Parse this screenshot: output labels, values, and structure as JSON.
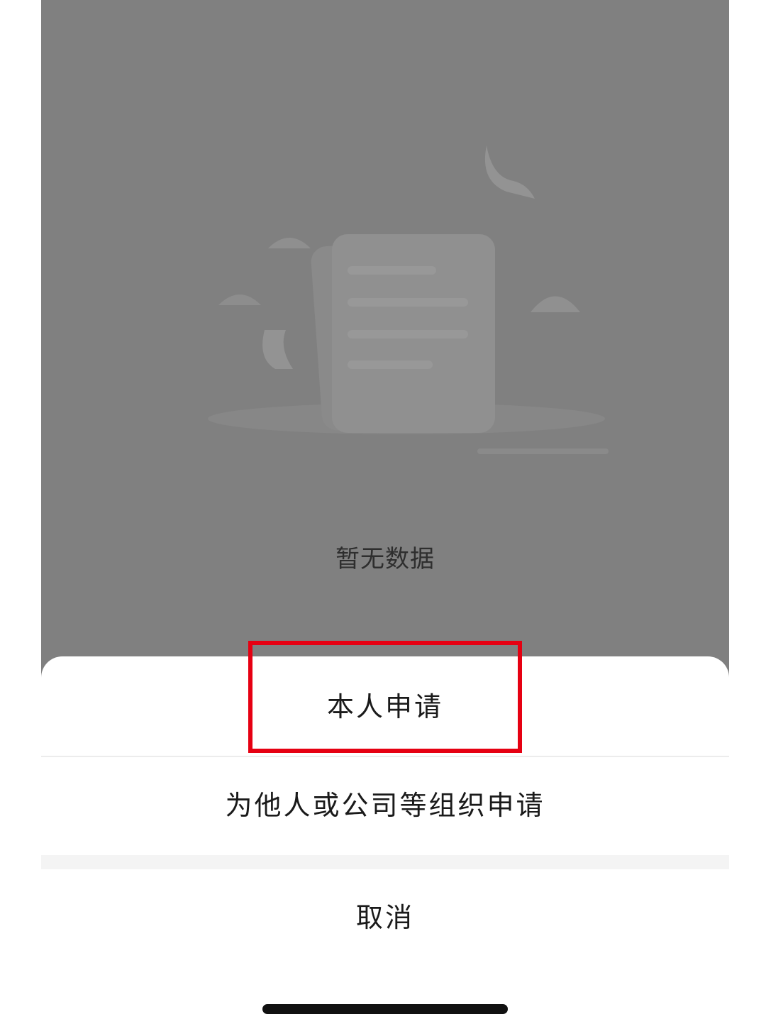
{
  "empty_state": {
    "icon": "empty-documents-icon",
    "message": "暂无数据"
  },
  "action_sheet": {
    "options": [
      {
        "label": "本人申请"
      },
      {
        "label": "为他人或公司等组织申请"
      }
    ],
    "cancel_label": "取消"
  },
  "highlight": {
    "color": "#e60012",
    "target": "本人申请"
  },
  "colors": {
    "overlay": "#808080",
    "sheet": "#ffffff"
  }
}
